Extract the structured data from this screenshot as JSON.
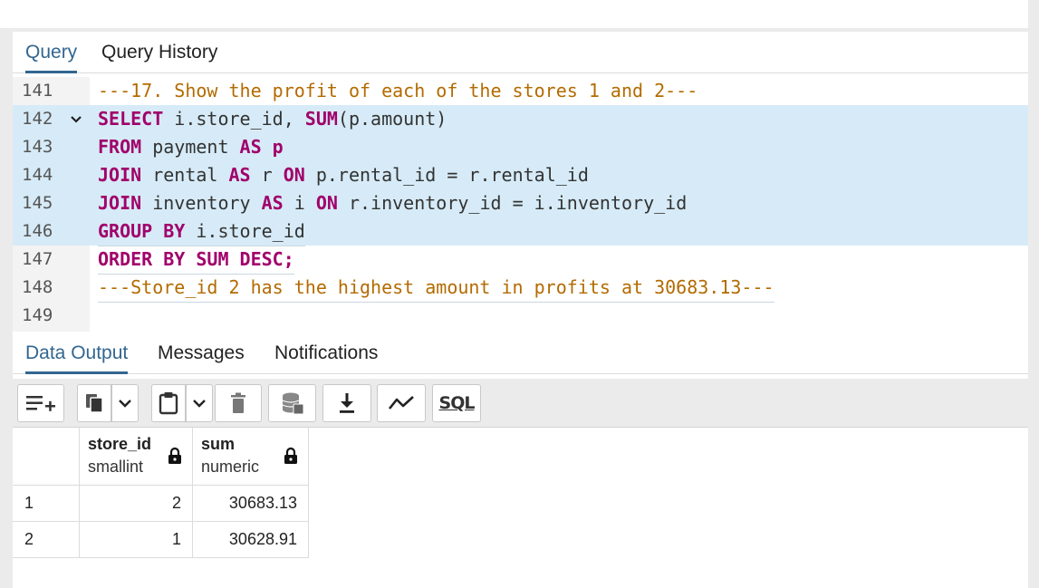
{
  "query_tabs": [
    "Query",
    "Query History"
  ],
  "editor": {
    "lines": [
      {
        "num": "141",
        "tokens": [
          {
            "t": "---17. Show the profit of each of the stores 1 and 2---",
            "c": "cm"
          }
        ]
      },
      {
        "num": "142",
        "fold": true,
        "tokens": [
          {
            "t": "SELECT",
            "c": "kw"
          },
          {
            "t": " i.store_id, "
          },
          {
            "t": "SUM",
            "c": "kw"
          },
          {
            "t": "(p.amount)"
          }
        ]
      },
      {
        "num": "143",
        "tokens": [
          {
            "t": "FROM",
            "c": "kw"
          },
          {
            "t": " payment "
          },
          {
            "t": "AS p",
            "c": "kw"
          }
        ]
      },
      {
        "num": "144",
        "tokens": [
          {
            "t": "JOIN",
            "c": "kw"
          },
          {
            "t": " rental "
          },
          {
            "t": "AS",
            "c": "kw"
          },
          {
            "t": " r "
          },
          {
            "t": "ON",
            "c": "kw"
          },
          {
            "t": " p.rental_id = r.rental_id"
          }
        ]
      },
      {
        "num": "145",
        "tokens": [
          {
            "t": "JOIN",
            "c": "kw"
          },
          {
            "t": " inventory "
          },
          {
            "t": "AS",
            "c": "kw"
          },
          {
            "t": " i "
          },
          {
            "t": "ON",
            "c": "kw"
          },
          {
            "t": " r.inventory_id = i.inventory_id"
          }
        ]
      },
      {
        "num": "146",
        "tokens": [
          {
            "t": "GROUP BY",
            "c": "kw"
          },
          {
            "t": " i.store_id"
          }
        ]
      },
      {
        "num": "147",
        "tokens": [
          {
            "t": "ORDER BY SUM DESC;",
            "c": "kw"
          }
        ]
      },
      {
        "num": "148",
        "tokens": [
          {
            "t": "---Store_id 2 has the highest amount in profits at 30683.13---",
            "c": "cm"
          }
        ]
      },
      {
        "num": "149",
        "tokens": []
      }
    ]
  },
  "result_tabs": [
    "Data Output",
    "Messages",
    "Notifications"
  ],
  "toolbar": {
    "icons": [
      "add-row-icon",
      "copy-icon",
      "chevron-down-icon",
      "paste-icon",
      "chevron-down-icon",
      "delete-icon",
      "save-data-icon",
      "download-icon",
      "graph-icon"
    ],
    "sql_label": "SQL"
  },
  "grid": {
    "columns": [
      {
        "name": "store_id",
        "type": "smallint"
      },
      {
        "name": "sum",
        "type": "numeric"
      }
    ],
    "rows": [
      {
        "num": "1",
        "cells": [
          "2",
          "30683.13"
        ]
      },
      {
        "num": "2",
        "cells": [
          "1",
          "30628.91"
        ]
      }
    ]
  },
  "colors": {
    "accent": "#326690",
    "keyword": "#a1006b",
    "comment": "#b36b00",
    "highlight": "#d6ebf7"
  }
}
